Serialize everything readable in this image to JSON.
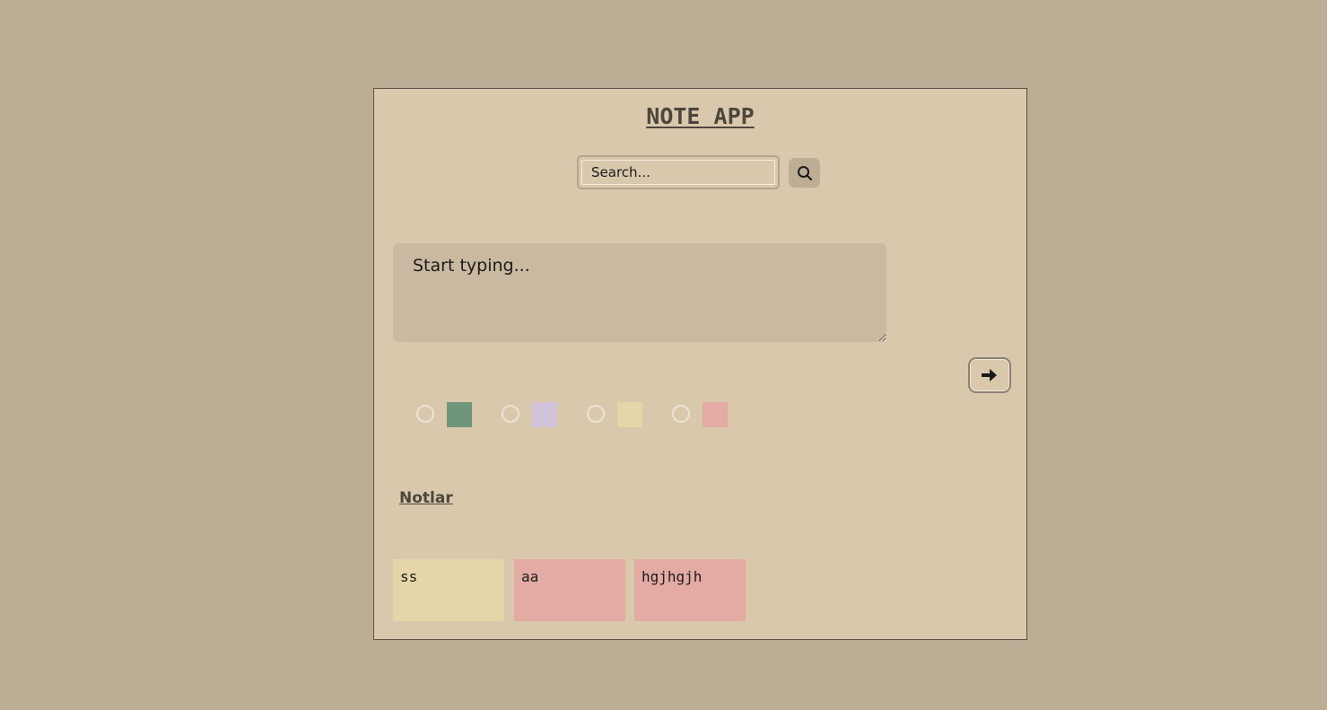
{
  "app": {
    "title": "NOTE APP"
  },
  "search": {
    "placeholder": "Search...",
    "button_icon": "search-icon"
  },
  "editor": {
    "placeholder": "Start typing..."
  },
  "submit": {
    "icon": "arrow-right-icon"
  },
  "colors": [
    {
      "name": "green",
      "hex": "#6f967a"
    },
    {
      "name": "lavender",
      "hex": "#d3c4db"
    },
    {
      "name": "yellow",
      "hex": "#e6d5a9"
    },
    {
      "name": "pink",
      "hex": "#e4aba5"
    }
  ],
  "notes_section": {
    "title": "Notlar"
  },
  "notes": [
    {
      "text": "ss",
      "color": "#e6d5a9"
    },
    {
      "text": "aa",
      "color": "#e4aba5"
    },
    {
      "text": "hgjhgjh",
      "color": "#e4aba5"
    }
  ]
}
